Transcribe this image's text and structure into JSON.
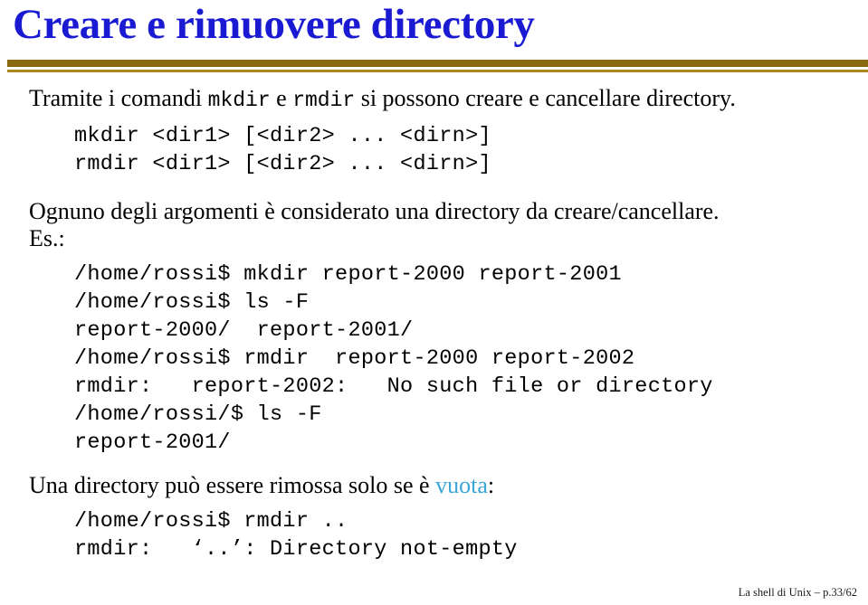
{
  "slide": {
    "title": "Creare e rimuovere directory",
    "intro": {
      "before_first_cmd": "Tramite i comandi ",
      "cmd1": "mkdir",
      "between_cmds": " e ",
      "cmd2": "rmdir",
      "after_cmds": " si possono creare e cancellare directory."
    },
    "syntax_lines": [
      "mkdir <dir1> [<dir2> ... <dirn>]",
      "rmdir <dir1> [<dir2> ... <dirn>]"
    ],
    "argument_note": "Ognuno degli argomenti è considerato una directory da creare/cancellare.",
    "example_label": "Es.:",
    "session_lines": [
      "/home/rossi$ mkdir report-2000 report-2001",
      "/home/rossi$ ls -F",
      "report-2000/  report-2001/",
      "/home/rossi$ rmdir  report-2000 report-2002",
      "rmdir:   report-2002:   No such file or directory",
      "/home/rossi/$ ls -F",
      "report-2001/"
    ],
    "empty_note": {
      "before_highlight": "Una directory può essere rimossa solo se è ",
      "highlight": "vuota",
      "after_highlight": ":"
    },
    "session_lines_2": [
      "/home/rossi$ rmdir ..",
      "rmdir:   ‘..’: Directory not-empty"
    ]
  },
  "footer": {
    "text": "La shell di Unix – p.33/62"
  },
  "colors": {
    "title": "#1a1ad2",
    "rule_thick": "#8a6a10",
    "rule_thin": "#a8881f",
    "highlight": "#3aa6d8",
    "background": "#ffffff",
    "text": "#000000"
  }
}
